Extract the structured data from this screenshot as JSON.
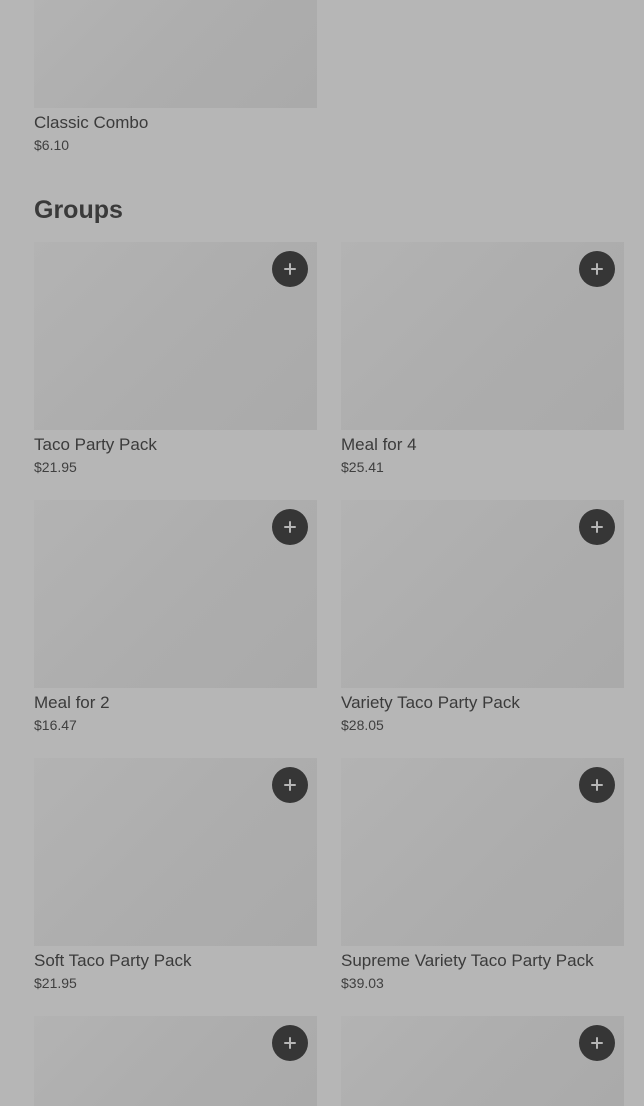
{
  "top_item": {
    "name": "Classic Combo",
    "price": "$6.10"
  },
  "groups": {
    "title": "Groups",
    "items": [
      {
        "name": "Taco Party Pack",
        "price": "$21.95"
      },
      {
        "name": "Meal for 4",
        "price": "$25.41"
      },
      {
        "name": "Meal for 2",
        "price": "$16.47"
      },
      {
        "name": "Variety Taco Party Pack",
        "price": "$28.05"
      },
      {
        "name": "Soft Taco Party Pack",
        "price": "$21.95"
      },
      {
        "name": "Supreme Variety Taco Party Pack",
        "price": "$39.03"
      }
    ]
  },
  "icons": {
    "add": "plus-icon"
  }
}
